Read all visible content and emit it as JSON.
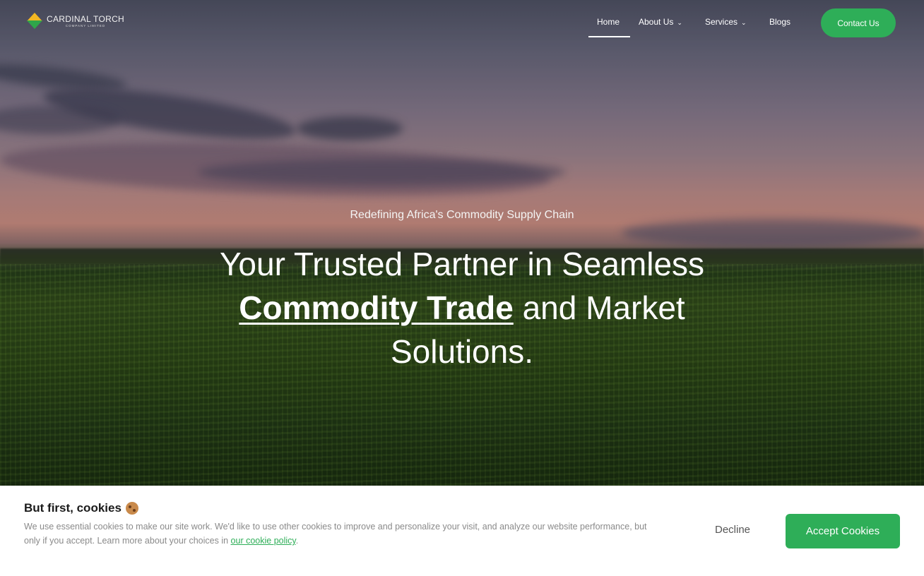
{
  "brand": {
    "name": "CARDINAL TORCH",
    "sub": "COMPANY LIMITED"
  },
  "nav": {
    "items": [
      {
        "label": "Home",
        "active": true
      },
      {
        "label": "About Us",
        "dropdown": true
      },
      {
        "label": "Services",
        "dropdown": true
      },
      {
        "label": "Blogs"
      }
    ],
    "cta": "Contact Us"
  },
  "hero": {
    "tagline": "Redefining Africa's Commodity Supply Chain",
    "heading_pre": "Your Trusted Partner in Seamless",
    "heading_highlight": "Commodity Trade",
    "heading_post": "and Market Solutions."
  },
  "cookie_banner": {
    "title": "But first, cookies",
    "text": "We use essential cookies to make our site work. We'd like to use other cookies to improve and personalize your visit, and analyze our website performance, but only if you accept. Learn more about your choices in",
    "link_text": "our cookie policy",
    "text_end": ".",
    "decline": "Decline",
    "accept": "Accept Cookies"
  },
  "colors": {
    "accent": "#2eae58",
    "logo_yellow": "#f2b722",
    "logo_green": "#2fa64a"
  },
  "icons": {
    "logo": "cardinal-torch-logo-icon",
    "dropdown": "chevron-down-icon",
    "cookie": "cookie-icon"
  }
}
